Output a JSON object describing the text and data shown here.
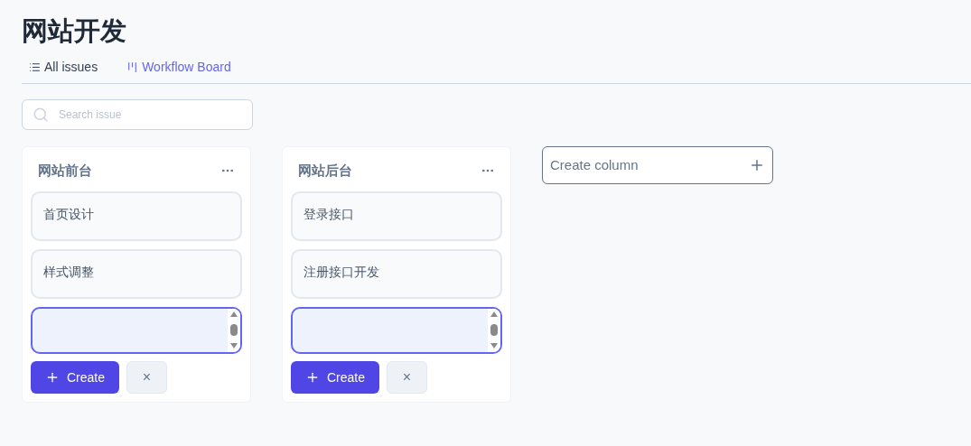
{
  "title": "网站开发",
  "tabs": [
    {
      "label": "All issues",
      "selected": false
    },
    {
      "label": "Workflow Board",
      "selected": true
    }
  ],
  "search": {
    "placeholder": "Search issue"
  },
  "columns": [
    {
      "name": "网站前台",
      "cards": [
        "首页设计",
        "样式调整"
      ],
      "create_button": "Create",
      "cancel_button": "×"
    },
    {
      "name": "网站后台",
      "cards": [
        "登录接口",
        "注册接口开发"
      ],
      "create_button": "Create",
      "cancel_button": "×"
    }
  ],
  "create_column": "Create column"
}
